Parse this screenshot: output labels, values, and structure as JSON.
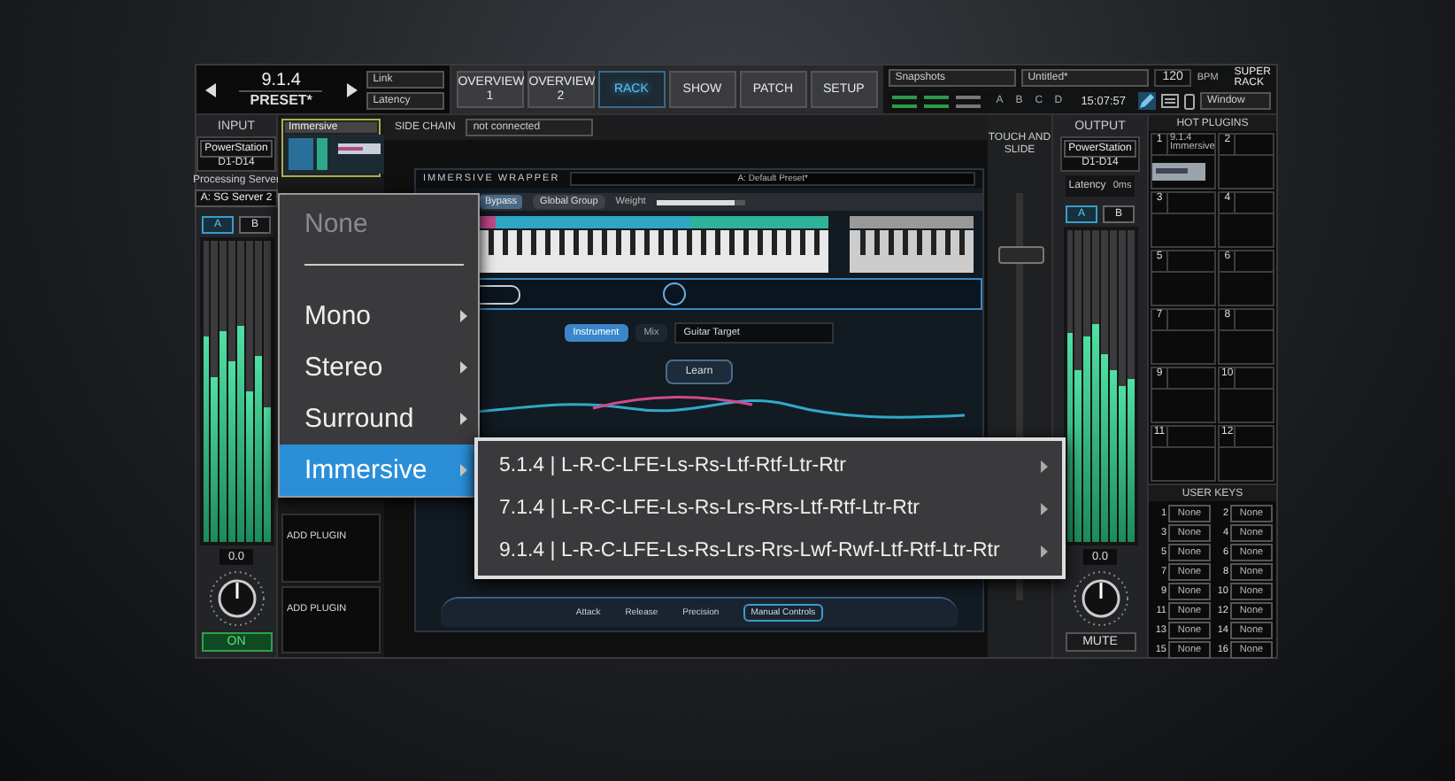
{
  "preset": {
    "name": "9.1.4",
    "label": "PRESET*"
  },
  "preset_options": [
    "Link",
    "Latency"
  ],
  "tabs": [
    {
      "label": "OVERVIEW 1",
      "selected": false
    },
    {
      "label": "OVERVIEW 2",
      "selected": false
    },
    {
      "label": "RACK",
      "selected": true
    },
    {
      "label": "SHOW",
      "selected": false
    },
    {
      "label": "PATCH",
      "selected": false
    },
    {
      "label": "SETUP",
      "selected": false
    }
  ],
  "snapshots": {
    "list": "Snapshots",
    "name": "Untitled*",
    "tempo": "120",
    "tempo_unit": "BPM",
    "scenes": [
      "A",
      "B",
      "C",
      "D"
    ],
    "clock": "15:07:57",
    "window": "Window"
  },
  "logo": {
    "line1": "SUPER",
    "line2": "RACK"
  },
  "input": {
    "title": "INPUT",
    "device": "PowerStation",
    "channels": "D1-D14",
    "server_label": "Processing Server",
    "server": "A: SG Server 2",
    "ab": [
      {
        "label": "A",
        "selected": true
      },
      {
        "label": "B",
        "selected": false
      }
    ],
    "meter": [
      {
        "level": 0.68
      },
      {
        "level": 0.55
      },
      {
        "level": 0.7
      },
      {
        "level": 0.6
      },
      {
        "level": 0.72
      },
      {
        "level": 0.5
      },
      {
        "level": 0.62
      },
      {
        "level": 0.45
      }
    ],
    "gain": "0.0",
    "power": {
      "label": "ON",
      "on": true
    }
  },
  "slots": [
    {
      "kind": "plugin",
      "name": "Immersive"
    },
    {
      "kind": "add",
      "label": "ADD PLUGIN"
    },
    {
      "kind": "add",
      "label": "ADD PLUGIN"
    }
  ],
  "side_chain": {
    "label": "SIDE CHAIN",
    "value": "not connected"
  },
  "plugin": {
    "title": "IMMERSIVE WRAPPER",
    "preset": "A: Default Preset*",
    "bypass": "Bypass",
    "group_label": "Global Group",
    "weight_label": "Weight",
    "weight": {
      "level": 0.88
    },
    "modes": [
      {
        "label": "Instrument",
        "selected": true
      },
      {
        "label": "Mix",
        "selected": false
      }
    ],
    "target": "Guitar Target",
    "learn": "Learn",
    "controls": [
      "Attack",
      "Release",
      "Precision"
    ],
    "manual": "Manual Controls"
  },
  "fader": {
    "label": "TOUCH AND SLIDE",
    "level": 0.85
  },
  "output": {
    "title": "OUTPUT",
    "device": "PowerStation",
    "channels": "D1-D14",
    "latency_label": "Latency",
    "latency": "0ms",
    "ab": [
      {
        "label": "A",
        "selected": true
      },
      {
        "label": "B",
        "selected": false
      }
    ],
    "meter": [
      {
        "level": 0.67
      },
      {
        "level": 0.55
      },
      {
        "level": 0.66
      },
      {
        "level": 0.7
      },
      {
        "level": 0.6
      },
      {
        "level": 0.55
      },
      {
        "level": 0.5
      },
      {
        "level": 0.52
      }
    ],
    "gain": "0.0",
    "mute": {
      "label": "MUTE",
      "on": false
    }
  },
  "hot_plugins": {
    "title": "HOT PLUGINS",
    "slots": [
      {
        "number": "1",
        "name": "9.1.4",
        "sub": "Immersive"
      },
      {
        "number": "2"
      },
      {
        "number": "3"
      },
      {
        "number": "4"
      },
      {
        "number": "5"
      },
      {
        "number": "6"
      },
      {
        "number": "7"
      },
      {
        "number": "8"
      },
      {
        "number": "9"
      },
      {
        "number": "10"
      },
      {
        "number": "11"
      },
      {
        "number": "12"
      }
    ]
  },
  "user_keys": {
    "title": "USER KEYS",
    "keys": [
      {
        "number": "1",
        "label": "None"
      },
      {
        "number": "2",
        "label": "None"
      },
      {
        "number": "3",
        "label": "None"
      },
      {
        "number": "4",
        "label": "None"
      },
      {
        "number": "5",
        "label": "None"
      },
      {
        "number": "6",
        "label": "None"
      },
      {
        "number": "7",
        "label": "None"
      },
      {
        "number": "8",
        "label": "None"
      },
      {
        "number": "9",
        "label": "None"
      },
      {
        "number": "10",
        "label": "None"
      },
      {
        "number": "11",
        "label": "None"
      },
      {
        "number": "12",
        "label": "None"
      },
      {
        "number": "13",
        "label": "None"
      },
      {
        "number": "14",
        "label": "None"
      },
      {
        "number": "15",
        "label": "None"
      },
      {
        "number": "16",
        "label": "None"
      }
    ]
  },
  "menu": {
    "items": [
      {
        "kind": "item",
        "label": "None",
        "disabled": true,
        "selected": false,
        "submenu": false
      },
      {
        "kind": "separator"
      },
      {
        "kind": "item",
        "label": "Mono",
        "disabled": false,
        "selected": false,
        "submenu": true
      },
      {
        "kind": "item",
        "label": "Stereo",
        "disabled": false,
        "selected": false,
        "submenu": true
      },
      {
        "kind": "item",
        "label": "Surround",
        "disabled": false,
        "selected": false,
        "submenu": true
      },
      {
        "kind": "item",
        "label": "Immersive",
        "disabled": false,
        "selected": true,
        "submenu": true
      }
    ],
    "submenu": [
      {
        "label": "5.1.4 | L-R-C-LFE-Ls-Rs-Ltf-Rtf-Ltr-Rtr",
        "submenu": true
      },
      {
        "label": "7.1.4 | L-R-C-LFE-Ls-Rs-Lrs-Rrs-Ltf-Rtf-Ltr-Rtr",
        "submenu": true
      },
      {
        "label": "9.1.4 | L-R-C-LFE-Ls-Rs-Lrs-Rrs-Lwf-Rwf-Ltf-Rtf-Ltr-Rtr",
        "submenu": true
      }
    ]
  }
}
